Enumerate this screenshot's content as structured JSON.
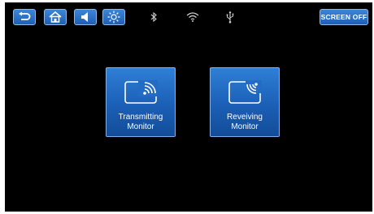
{
  "toolbar": {
    "buttons": [
      {
        "id": "back",
        "icon": "back-arrow-icon"
      },
      {
        "id": "home",
        "icon": "home-icon"
      },
      {
        "id": "volume",
        "icon": "speaker-icon"
      },
      {
        "id": "brightness",
        "icon": "sun-icon"
      }
    ],
    "status_icons": [
      "bluetooth-icon",
      "wifi-icon",
      "usb-icon"
    ],
    "screen_off_label": "SCREEN OFF"
  },
  "tiles": [
    {
      "id": "transmitting",
      "icon": "cast-monitor-icon",
      "label_line1": "Transmitting",
      "label_line2": "Monitor"
    },
    {
      "id": "receiving",
      "icon": "receive-monitor-icon",
      "label_line1": "Reveiving",
      "label_line2": "Monitor"
    }
  ],
  "colors": {
    "background": "#000000",
    "button_blue": "#2a72c9",
    "border": "#8fbbe6",
    "text": "#ffffff"
  }
}
